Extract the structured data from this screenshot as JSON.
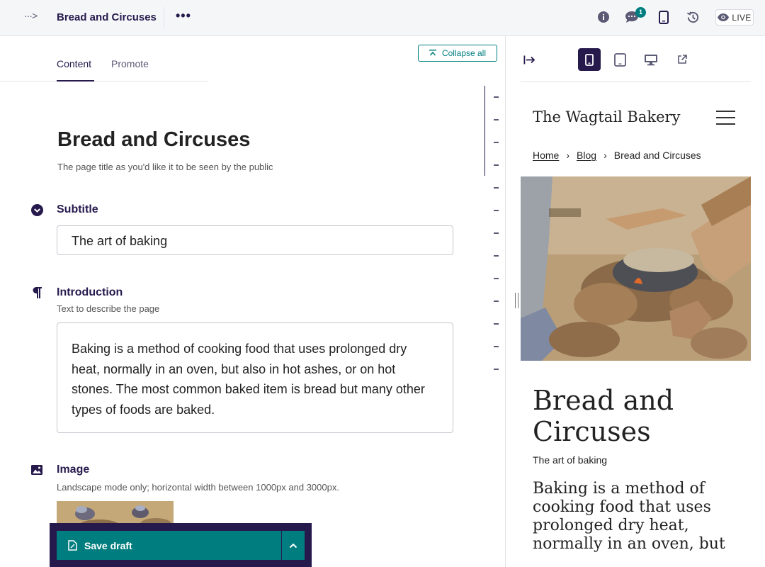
{
  "header": {
    "breadcrumb_toggle": "···>",
    "page_name": "Bread and Circuses",
    "more_label": "•••",
    "comments_count": "1",
    "live_label": "LIVE"
  },
  "tabs": [
    {
      "label": "Content",
      "active": true
    },
    {
      "label": "Promote",
      "active": false
    }
  ],
  "collapse_all_label": "Collapse all",
  "title_field": {
    "value": "Bread and Circuses",
    "help": "The page title as you'd like it to be seen by the public"
  },
  "subtitle_field": {
    "label": "Subtitle",
    "value": "The art of baking",
    "icon": "chevron-circle-icon"
  },
  "introduction_field": {
    "label": "Introduction",
    "help": "Text to describe the page",
    "value": "Baking is a method of cooking food that uses prolonged dry heat, normally in an oven, but also in hot ashes, or on hot stones. The most common baked item is bread but many other types of foods are baked.",
    "icon": "pilcrow-icon"
  },
  "image_field": {
    "label": "Image",
    "help": "Landscape mode only; horizontal width between 1000px and 3000px.",
    "icon": "image-icon"
  },
  "save": {
    "label": "Save draft"
  },
  "preview": {
    "site_name": "The Wagtail Bakery",
    "breadcrumb": [
      "Home",
      "Blog",
      "Bread and Circuses"
    ],
    "title": "Bread and Circuses",
    "subtitle": "The art of baking",
    "intro": "Baking is a method of cooking food that uses prolonged dry heat, normally in an oven, but"
  },
  "colors": {
    "brand": "#261a4d",
    "accent": "#007d7e",
    "border": "#e3e3e8"
  }
}
